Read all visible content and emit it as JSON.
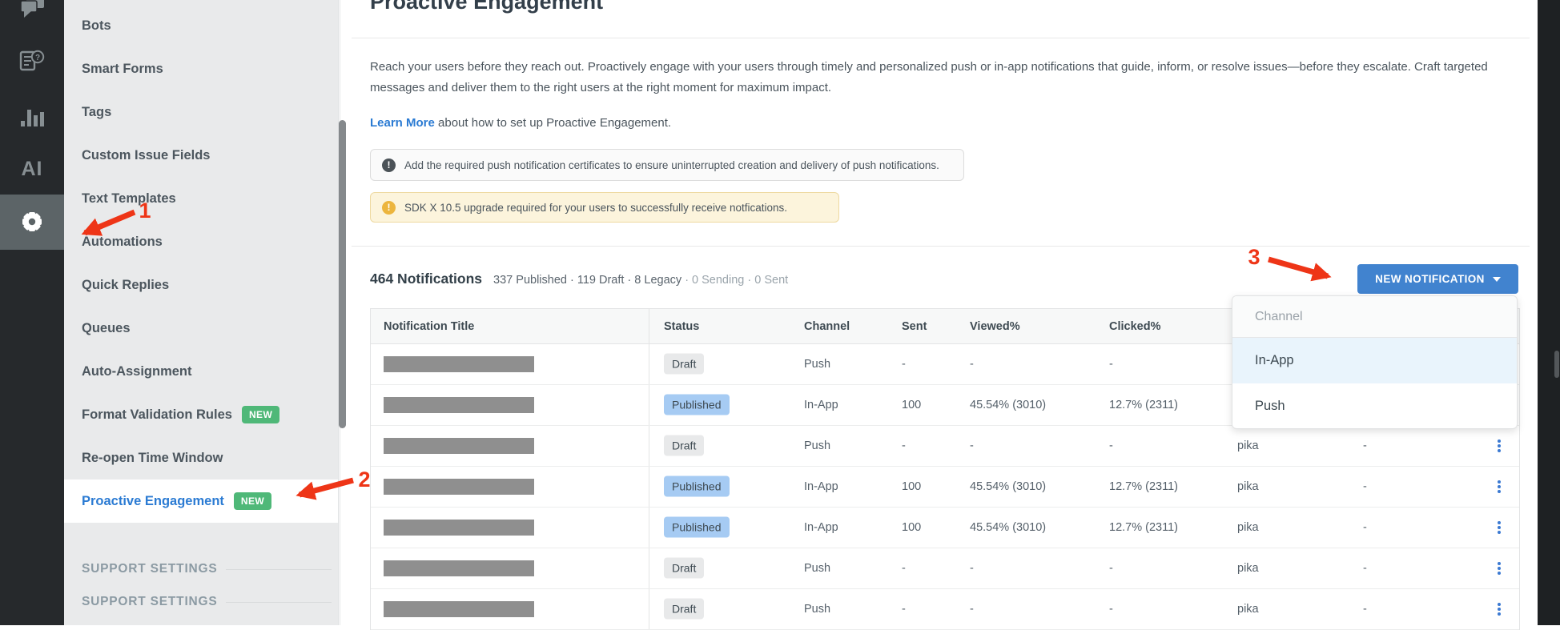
{
  "nav_rail": {
    "icons": [
      "chat-icon",
      "faq-icon",
      "analytics-icon",
      "ai-icon",
      "settings-icon"
    ],
    "ai_label": "AI",
    "active_icon": "settings-icon"
  },
  "sidebar": {
    "items": [
      {
        "label": "Bots"
      },
      {
        "label": "Smart Forms"
      },
      {
        "label": "Tags"
      },
      {
        "label": "Custom Issue Fields"
      },
      {
        "label": "Text Templates"
      },
      {
        "label": "Automations"
      },
      {
        "label": "Quick Replies"
      },
      {
        "label": "Queues"
      },
      {
        "label": "Auto-Assignment"
      },
      {
        "label": "Format Validation Rules",
        "badge": "NEW"
      },
      {
        "label": "Re-open Time Window"
      },
      {
        "label": "Proactive Engagement",
        "badge": "NEW",
        "active": true
      }
    ],
    "section_headers": [
      "SUPPORT SETTINGS",
      "SUPPORT SETTINGS"
    ]
  },
  "annotations": {
    "color": "#ee3517",
    "labels": [
      "1",
      "2",
      "3"
    ]
  },
  "main": {
    "title": "Proactive Engagement",
    "description": "Reach your users before they reach out. Proactively engage with your users through timely and personalized push or in-app notifications that guide, inform, or resolve issues—before they escalate. Craft targeted messages and deliver them to the right users at the right moment for maximum impact.",
    "learn_more_label": "Learn More",
    "learn_more_rest": " about how to set up Proactive Engagement.",
    "alerts": [
      {
        "type": "info",
        "icon": "exclamation-icon",
        "text": "Add the required push notification certificates to ensure uninterrupted creation and delivery of push notifications."
      },
      {
        "type": "warning",
        "icon": "exclamation-icon",
        "text": "SDK X 10.5 upgrade required for your users to successfully receive notfications."
      }
    ],
    "summary": {
      "count_label": "464 Notifications",
      "stats_primary": "337 Published · 119 Draft · 8 Legacy",
      "stats_muted": "· 0 Sending · 0 Sent"
    },
    "new_notification_button": {
      "label": "NEW NOTIFICATION"
    },
    "dropdown": {
      "header": "Channel",
      "options": [
        {
          "label": "In-App",
          "highlighted": true
        },
        {
          "label": "Push",
          "highlighted": false
        }
      ]
    },
    "table": {
      "columns": [
        "Notification Title",
        "Status",
        "Channel",
        "Sent",
        "Viewed%",
        "Clicked%"
      ],
      "rows": [
        {
          "status": "Draft",
          "variant": "draft",
          "channel": "Push",
          "sent": "-",
          "viewed": "-",
          "clicked": "-",
          "creator": "",
          "col7": "",
          "kebab": false
        },
        {
          "status": "Published",
          "variant": "published",
          "channel": "In-App",
          "sent": "100",
          "viewed": "45.54% (3010)",
          "clicked": "12.7% (2311)",
          "creator": "",
          "col7": "",
          "kebab": false
        },
        {
          "status": "Draft",
          "variant": "draft",
          "channel": "Push",
          "sent": "-",
          "viewed": "-",
          "clicked": "-",
          "creator": "pika",
          "col7": "-",
          "kebab": true
        },
        {
          "status": "Published",
          "variant": "published",
          "channel": "In-App",
          "sent": "100",
          "viewed": "45.54% (3010)",
          "clicked": "12.7% (2311)",
          "creator": "pika",
          "col7": "-",
          "kebab": true
        },
        {
          "status": "Published",
          "variant": "published",
          "channel": "In-App",
          "sent": "100",
          "viewed": "45.54% (3010)",
          "clicked": "12.7% (2311)",
          "creator": "pika",
          "col7": "-",
          "kebab": true
        },
        {
          "status": "Draft",
          "variant": "draft",
          "channel": "Push",
          "sent": "-",
          "viewed": "-",
          "clicked": "-",
          "creator": "pika",
          "col7": "-",
          "kebab": true
        },
        {
          "status": "Draft",
          "variant": "draft",
          "channel": "Push",
          "sent": "-",
          "viewed": "-",
          "clicked": "-",
          "creator": "pika",
          "col7": "-",
          "kebab": true
        }
      ]
    }
  },
  "colors": {
    "rail_bg": "#26292c",
    "rail_active_bg": "#5c6467",
    "sidebar_bg": "#e9eaeb",
    "accent_blue": "#2b7bd3",
    "button_blue": "#4183cf",
    "badge_green": "#4fb878",
    "published_badge": "#a6cbf3",
    "draft_badge": "#e8e9ea",
    "warning_bg": "#fcf4dc",
    "warning_icon": "#ecb53e",
    "annotation_red": "#ee3517",
    "kebab_blue": "#3b79d2",
    "right_strip": "#1e2123"
  }
}
